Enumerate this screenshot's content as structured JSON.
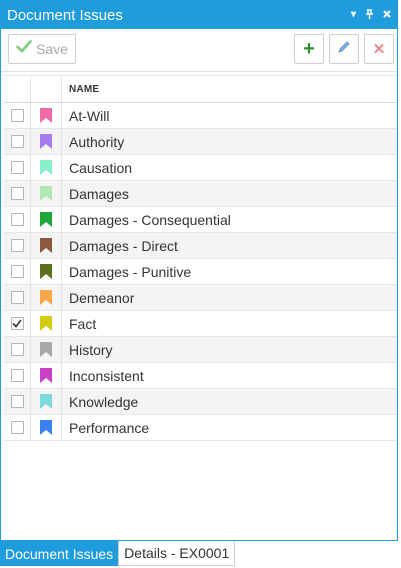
{
  "panel": {
    "title": "Document Issues",
    "controls": {
      "dropdown": "▾",
      "pin": "⊥",
      "close": "×"
    }
  },
  "toolbar": {
    "save_label": "Save",
    "add_symbol": "+",
    "delete_symbol": "✕"
  },
  "grid": {
    "header": {
      "name": "NAME"
    },
    "rows": [
      {
        "name": "At-Will",
        "color": "#f06aa8",
        "checked": false
      },
      {
        "name": "Authority",
        "color": "#a77bf0",
        "checked": false
      },
      {
        "name": "Causation",
        "color": "#86f0c8",
        "checked": false
      },
      {
        "name": "Damages",
        "color": "#b2e8b6",
        "checked": false
      },
      {
        "name": "Damages - Consequential",
        "color": "#1fa63a",
        "checked": false
      },
      {
        "name": "Damages - Direct",
        "color": "#8c5a3c",
        "checked": false
      },
      {
        "name": "Damages - Punitive",
        "color": "#5b6f1d",
        "checked": false
      },
      {
        "name": "Demeanor",
        "color": "#f7a64a",
        "checked": false
      },
      {
        "name": "Fact",
        "color": "#d3cc12",
        "checked": true
      },
      {
        "name": "History",
        "color": "#a9a9a9",
        "checked": false
      },
      {
        "name": "Inconsistent",
        "color": "#c841c4",
        "checked": false
      },
      {
        "name": "Knowledge",
        "color": "#7dd9de",
        "checked": false
      },
      {
        "name": "Performance",
        "color": "#3b82f0",
        "checked": false
      }
    ]
  },
  "tabs": [
    {
      "label": "Document Issues",
      "active": true
    },
    {
      "label": "Details - EX0001",
      "active": false
    }
  ]
}
